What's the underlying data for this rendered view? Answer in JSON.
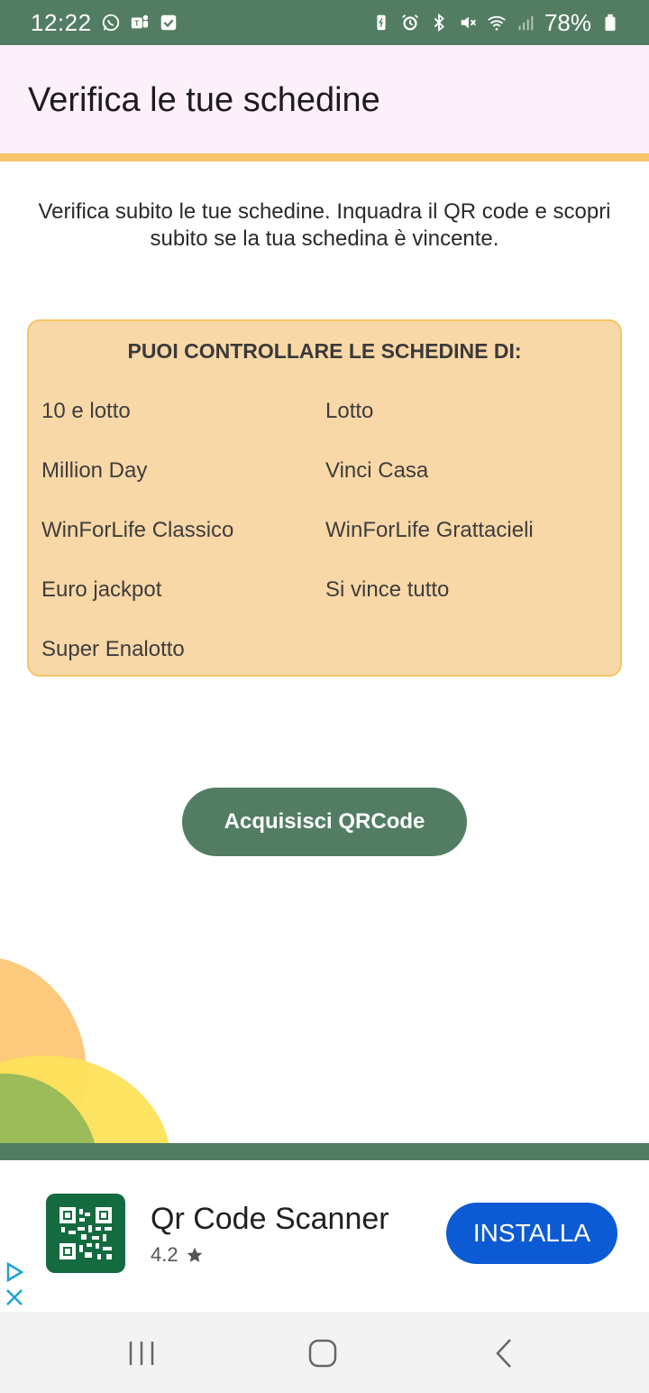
{
  "status_bar": {
    "time": "12:22",
    "battery": "78%",
    "left_icons": [
      "whatsapp-icon",
      "teams-icon",
      "check-icon"
    ],
    "right_icons": [
      "battery-saver-icon",
      "alarm-icon",
      "bluetooth-icon",
      "mute-icon",
      "wifi-icon",
      "signal-icon",
      "battery-icon"
    ]
  },
  "app_bar": {
    "title": "Verifica le tue schedine"
  },
  "intro": {
    "text": "Verifica subito le tue schedine. Inquadra il QR code e scopri subito se la tua schedina è vincente."
  },
  "games": {
    "heading": "PUOI CONTROLLARE LE SCHEDINE DI:",
    "items": [
      "10 e lotto",
      "Lotto",
      "Million Day",
      "Vinci Casa",
      "WinForLife Classico",
      "WinForLife Grattacieli",
      "Euro jackpot",
      "Si vince tutto",
      "Super Enalotto"
    ]
  },
  "scan_button": {
    "label": "Acquisisci QRCode"
  },
  "ad": {
    "title": "Qr Code Scanner",
    "rating": "4.2",
    "install_label": "INSTALLA"
  },
  "colors": {
    "primary": "#537d63",
    "accent": "#f7c36c",
    "box_bg": "#f9d8a7",
    "install": "#0c5bd4"
  }
}
